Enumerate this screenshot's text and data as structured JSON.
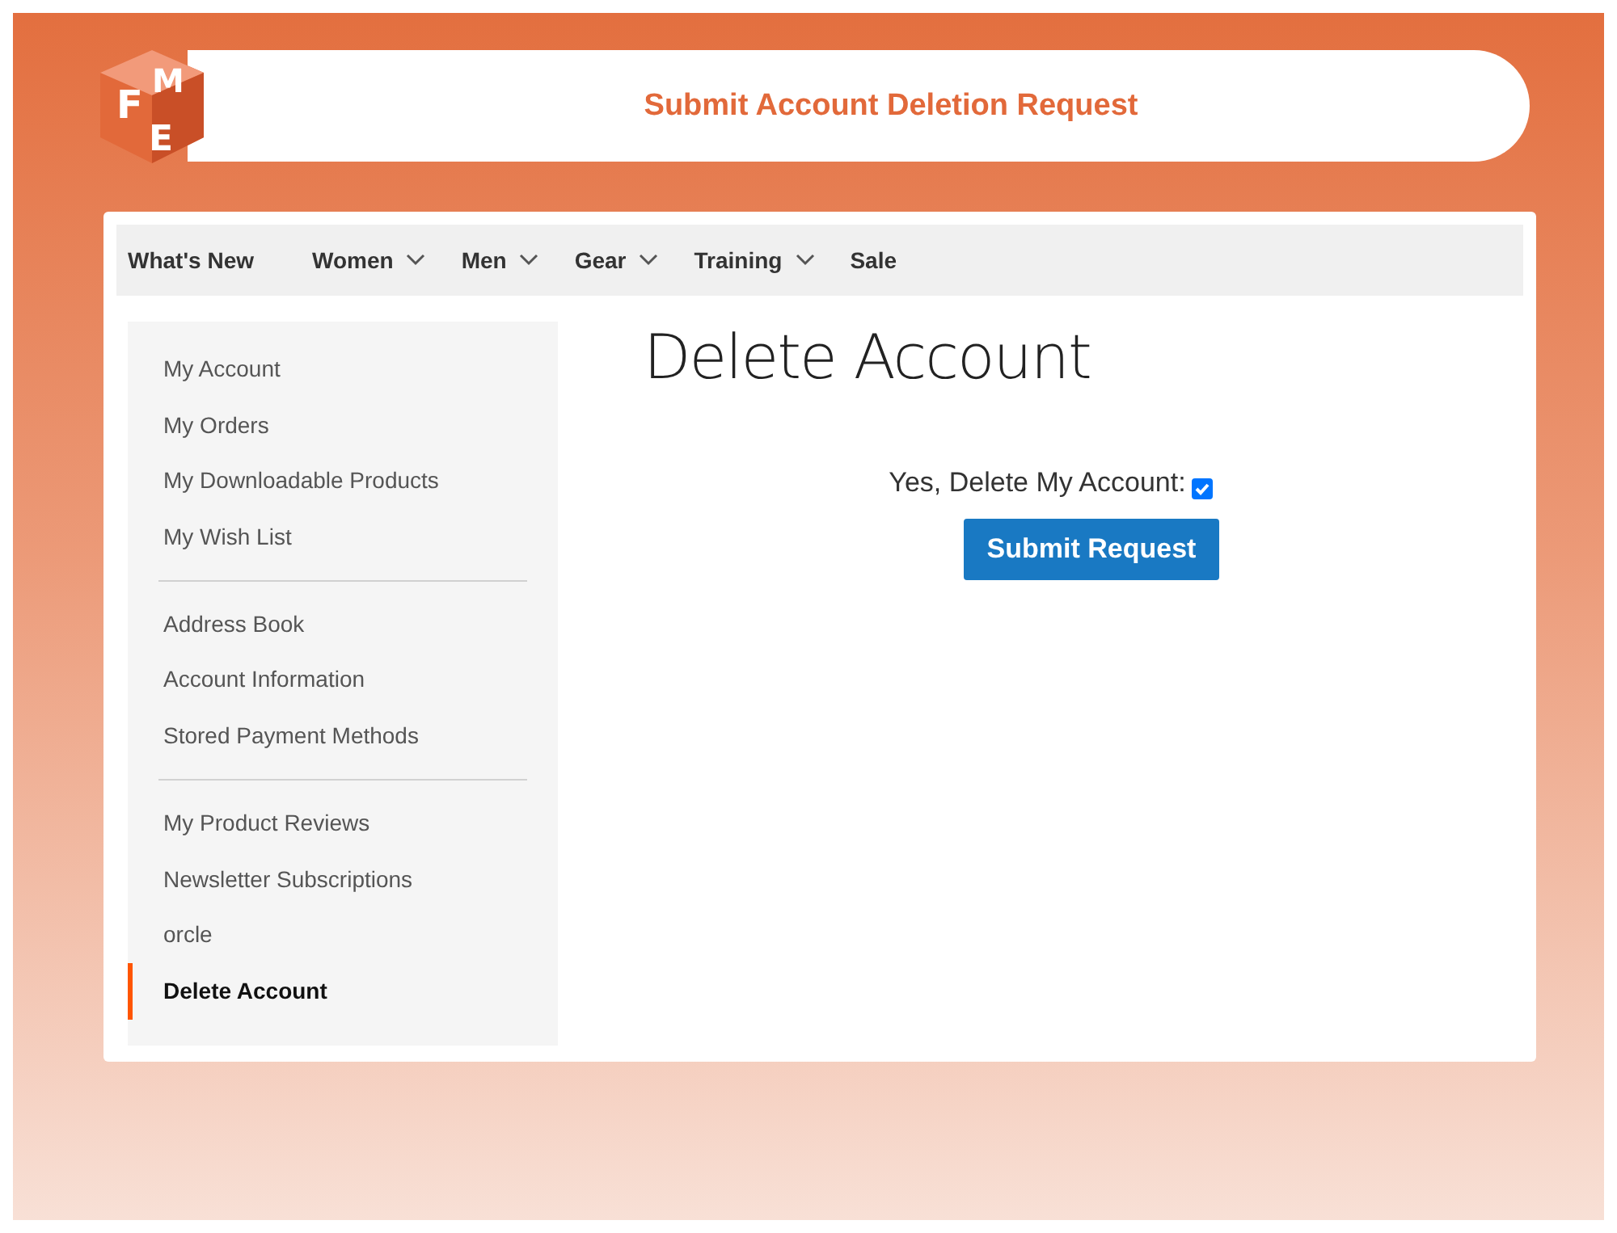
{
  "banner": {
    "logo_letters": [
      "F",
      "M",
      "E"
    ],
    "title": "Submit Account Deletion Request"
  },
  "nav": [
    {
      "label": "What's New",
      "dropdown": false
    },
    {
      "label": "Women",
      "dropdown": true
    },
    {
      "label": "Men",
      "dropdown": true
    },
    {
      "label": "Gear",
      "dropdown": true
    },
    {
      "label": "Training",
      "dropdown": true
    },
    {
      "label": "Sale",
      "dropdown": false
    }
  ],
  "sidebar": {
    "groups": [
      [
        {
          "label": "My Account",
          "selected": false
        },
        {
          "label": "My Orders",
          "selected": false
        },
        {
          "label": "My Downloadable Products",
          "selected": false
        },
        {
          "label": "My Wish List",
          "selected": false
        }
      ],
      [
        {
          "label": "Address Book",
          "selected": false
        },
        {
          "label": "Account Information",
          "selected": false
        },
        {
          "label": "Stored Payment Methods",
          "selected": false
        }
      ],
      [
        {
          "label": "My Product Reviews",
          "selected": false
        },
        {
          "label": "Newsletter Subscriptions",
          "selected": false
        },
        {
          "label": "orcle",
          "selected": false
        },
        {
          "label": "Delete Account",
          "selected": true
        }
      ]
    ]
  },
  "main": {
    "heading": "Delete Account",
    "confirm": {
      "label": "Yes, Delete My Account:",
      "checked": true
    },
    "button": "Submit Request"
  }
}
